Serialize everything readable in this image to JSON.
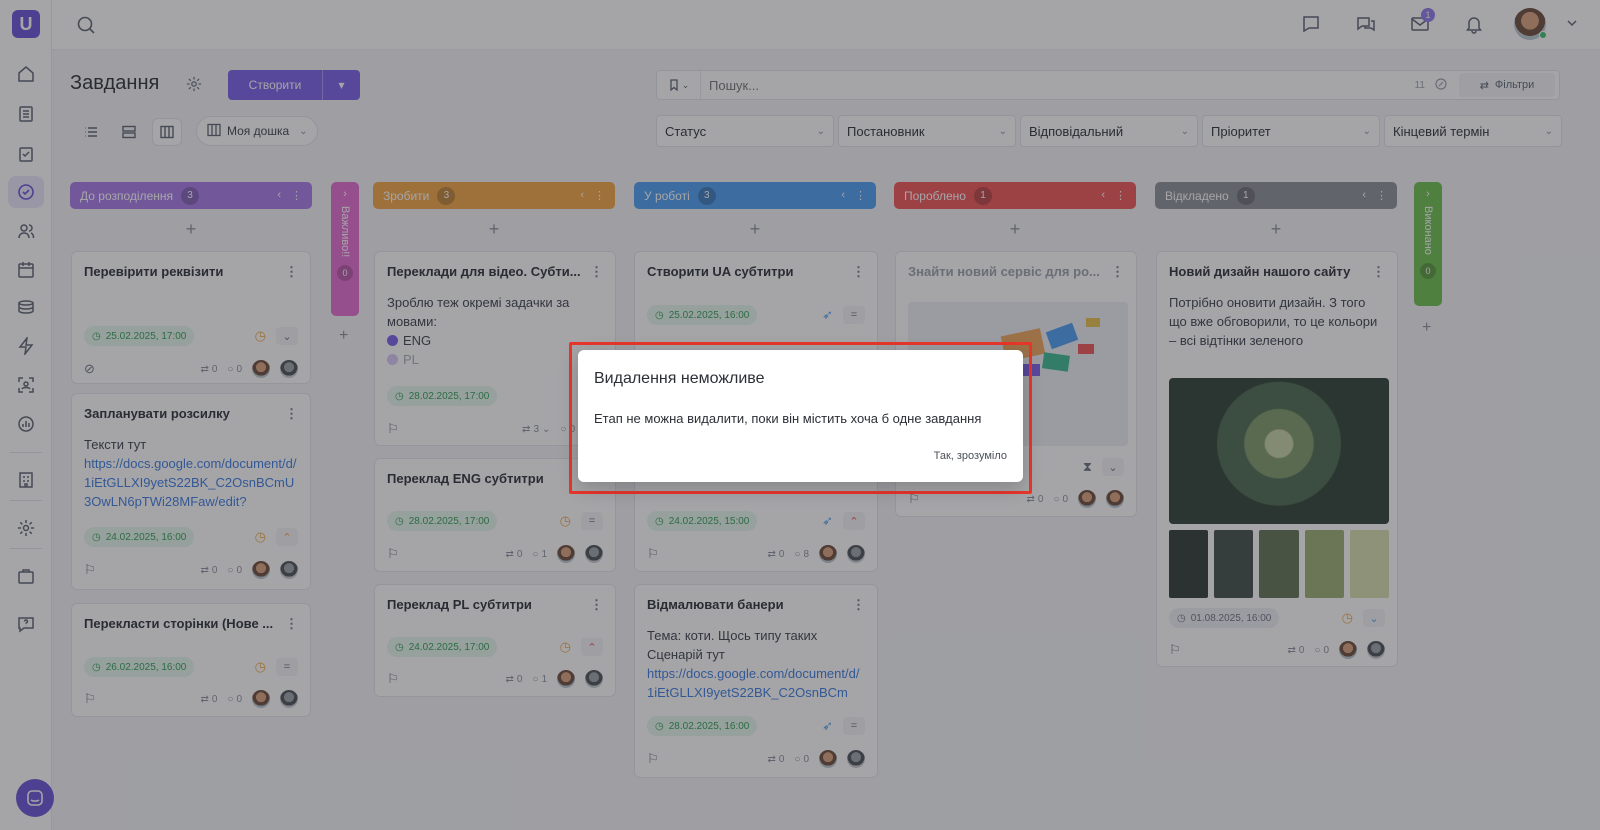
{
  "sidebar": {
    "logo": "U",
    "icons": [
      "home-icon",
      "list-icon",
      "checklist-icon",
      "tasks-icon",
      "users-icon",
      "calendar-icon",
      "layers-icon",
      "lightning-icon",
      "scan-icon",
      "chart-icon",
      "building-icon",
      "gear-icon",
      "briefcase-icon",
      "help-icon"
    ],
    "active_icon": "tasks-icon"
  },
  "topbar": {
    "mail_badge": "1",
    "icons": [
      "search-icon",
      "message-icon",
      "chat-icon",
      "mail-icon",
      "bell-icon"
    ]
  },
  "header": {
    "title": "Завдання",
    "create_label": "Створити",
    "board_select": "Моя дошка",
    "search_placeholder": "Пошук...",
    "search_counter": "11",
    "filters_label": "Фільтри"
  },
  "filters": [
    "Статус",
    "Постановник",
    "Відповідальний",
    "Пріоритет",
    "Кінцевий термін"
  ],
  "columns": [
    {
      "name": "До розподілення",
      "count": "3",
      "color": "#a87be8"
    },
    {
      "name": "Зробити",
      "count": "3",
      "color": "#f2a640"
    },
    {
      "name": "У роботі",
      "count": "3",
      "color": "#4a9ef2"
    },
    {
      "name": "Порoблено",
      "count": "1",
      "color": "#f05454"
    },
    {
      "name": "Відкладено",
      "count": "1",
      "color": "#8c8f96"
    }
  ],
  "collapsed": [
    {
      "name": "Важливо!!",
      "count": "0",
      "color": "#e66bd1"
    },
    {
      "name": "Виконано",
      "count": "0",
      "color": "#6cc04a"
    }
  ],
  "cards": {
    "c1": {
      "title": "Перевірити реквізити",
      "date": "25.02.2025, 17:00",
      "comments": "0",
      "attach": "0"
    },
    "c2": {
      "title": "Запланувати розсилку",
      "desc": "Тексти тут",
      "link": "https://docs.google.com/document/d/1iEtGLLXI9yetS22BK_C2OsnBCmU3OwLN6pTWi28MFaw/edit?",
      "date": "24.02.2025, 16:00",
      "comments": "0",
      "attach": "0"
    },
    "c3": {
      "title": "Перекласти сторінки (Нове ...",
      "date": "26.02.2025, 16:00",
      "comments": "0",
      "attach": "0"
    },
    "c4": {
      "title": "Переклади для відео. Субти...",
      "desc": "Зроблю теж окремі задачки за мовами:",
      "tag1": "ENG",
      "tag2": "PL",
      "date": "28.02.2025, 17:00",
      "subtasks": "3",
      "comments": "0"
    },
    "c5": {
      "title": "Переклад ENG субтитри",
      "date": "28.02.2025, 17:00",
      "attach": "0",
      "comments": "1"
    },
    "c6": {
      "title": "Переклад PL субтитри",
      "date": "24.02.2025, 17:00",
      "attach": "0",
      "comments": "1"
    },
    "c7": {
      "title": "Створити UA субтитри",
      "date": "25.02.2025, 16:00"
    },
    "c8": {
      "date": "24.02.2025, 15:00",
      "attach": "0",
      "comments": "8"
    },
    "c9": {
      "title": "Відмалювати банери",
      "desc1": "Тема: коти. Щось типу таких",
      "desc2": "Сценарій тут",
      "link": "https://docs.google.com/document/d/1iEtGLLXI9yetS22BK_C2OsnBCm",
      "date": "28.02.2025, 16:00",
      "attach": "0",
      "comments": "0"
    },
    "c10": {
      "title": "Знайти новий сервіс для ро...",
      "attach": "0",
      "comments": "0"
    },
    "c11": {
      "title": "Новий дизайн нашого сайту",
      "desc": "Потрібно оновити дизайн. З того що вже обговорили, то це кольори – всі відтінки зеленого",
      "date": "01.08.2025, 16:00",
      "attach": "0",
      "comments": "0"
    }
  },
  "modal": {
    "title": "Видалення неможливе",
    "text": "Етап не можна видалити, поки він містить хоча б одне завдання",
    "button": "Так, зрозуміло"
  }
}
